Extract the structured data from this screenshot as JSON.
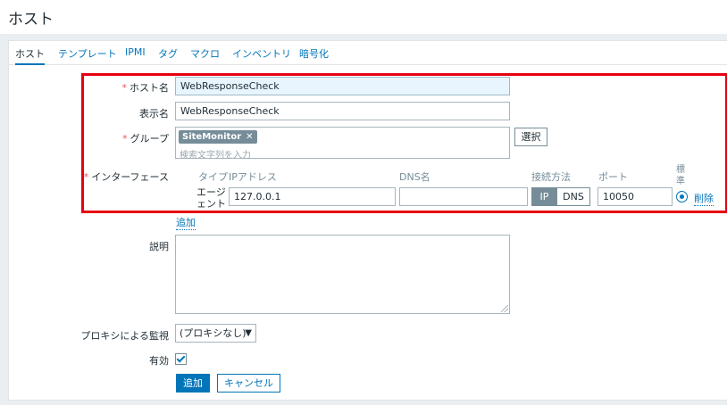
{
  "page": {
    "title": "ホスト"
  },
  "tabs": [
    {
      "label": "ホスト",
      "active": true
    },
    {
      "label": "テンプレート"
    },
    {
      "label": "IPMI"
    },
    {
      "label": "タグ"
    },
    {
      "label": "マクロ"
    },
    {
      "label": "インベントリ"
    },
    {
      "label": "暗号化"
    }
  ],
  "form": {
    "host_name": {
      "label": "ホスト名",
      "value": "WebResponseCheck",
      "required": "*"
    },
    "visible_name": {
      "label": "表示名",
      "value": "WebResponseCheck"
    },
    "groups": {
      "label": "グループ",
      "required": "*",
      "selected": [
        "SiteMonitor"
      ],
      "placeholder": "検索文字列を入力",
      "select_button": "選択"
    },
    "interfaces": {
      "label": "インターフェース",
      "required": "*",
      "headers": {
        "type": "タイプ",
        "ip": "IPアドレス",
        "dns": "DNS名",
        "connect": "接続方法",
        "port": "ポート",
        "default": "標準"
      },
      "rows": [
        {
          "type": "エージェント",
          "ip": "127.0.0.1",
          "dns": "",
          "connect_ip": "IP",
          "connect_dns": "DNS",
          "connect_selected": "IP",
          "port": "10050",
          "default": true,
          "remove": "削除"
        }
      ],
      "add_link": "追加"
    },
    "description": {
      "label": "説明",
      "value": ""
    },
    "proxy": {
      "label": "プロキシによる監視",
      "value": "(プロキシなし)"
    },
    "enabled": {
      "label": "有効",
      "checked": true
    },
    "buttons": {
      "add": "追加",
      "cancel": "キャンセル"
    }
  },
  "colors": {
    "accent": "#0275b8",
    "required": "#e45959",
    "highlight_box": "#e60012",
    "segment_selected": "#768d99"
  }
}
